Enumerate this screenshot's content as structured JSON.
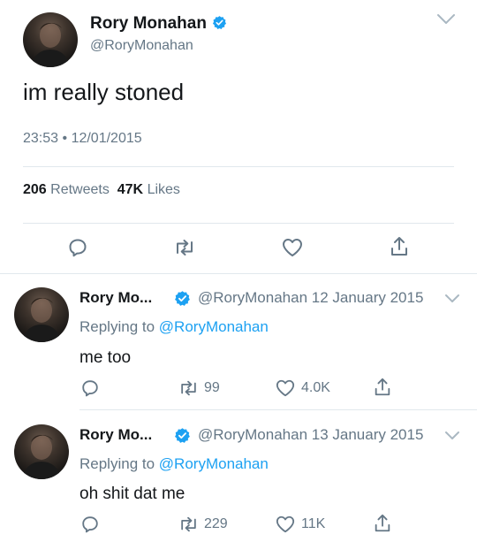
{
  "main": {
    "name": "Rory Monahan",
    "handle": "@RoryMonahan",
    "text": "im really stoned",
    "time": "23:53",
    "separator": "•",
    "date": "12/01/2015",
    "retweets_count": "206",
    "retweets_label": "Retweets",
    "likes_count": "47K",
    "likes_label": "Likes"
  },
  "replies": [
    {
      "name": "Rory Mo...",
      "handle_date": "@RoryMonahan 12 January 2015",
      "replying_prefix": "Replying to",
      "replying_to": "@RoryMonahan",
      "text": "me too",
      "retweets": "99",
      "likes": "4.0K"
    },
    {
      "name": "Rory Mo...",
      "handle_date": "@RoryMonahan 13 January 2015",
      "replying_prefix": "Replying to",
      "replying_to": "@RoryMonahan",
      "text": "oh shit dat me",
      "retweets": "229",
      "likes": "11K"
    }
  ],
  "colors": {
    "verified": "#1da1f2",
    "link": "#1da1f2",
    "secondary_text": "#657786",
    "divider": "#e1e8ed"
  },
  "icons": [
    "verified-badge-icon",
    "chevron-down-icon",
    "reply-icon",
    "retweet-icon",
    "like-icon",
    "share-icon"
  ]
}
